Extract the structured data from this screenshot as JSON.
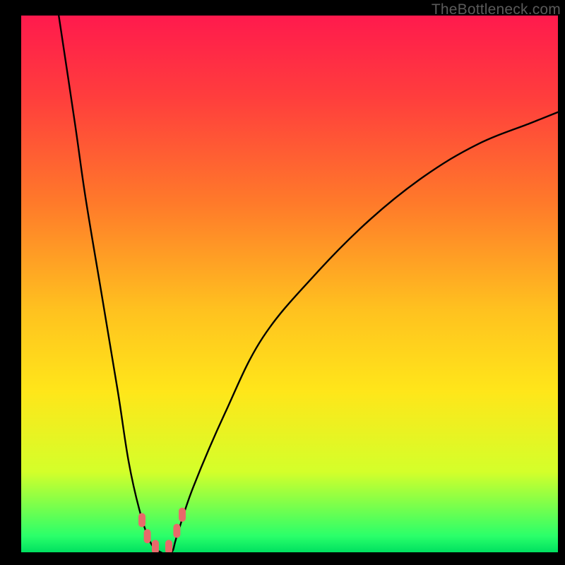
{
  "watermark": "TheBottleneck.com",
  "chart_data": {
    "type": "line",
    "title": "",
    "xlabel": "",
    "ylabel": "",
    "xlim": [
      0,
      100
    ],
    "ylim": [
      0,
      100
    ],
    "background_gradient": {
      "top": "#ff1a4d",
      "mid_high": "#ff7a2a",
      "mid": "#ffe61a",
      "bottom": "#00e060",
      "meaning_top": "bad",
      "meaning_bottom": "good"
    },
    "series": [
      {
        "name": "bottleneck-curve",
        "x": [
          7,
          10,
          12,
          15,
          18,
          20,
          22,
          24,
          26,
          28,
          29,
          32,
          38,
          45,
          55,
          65,
          75,
          85,
          95,
          100
        ],
        "y": [
          100,
          80,
          66,
          48,
          30,
          17,
          8,
          2,
          0,
          0,
          3,
          12,
          26,
          40,
          52,
          62,
          70,
          76,
          80,
          82
        ]
      }
    ],
    "markers": [
      {
        "name": "indicator",
        "x": 22.5,
        "y": 6
      },
      {
        "name": "indicator",
        "x": 23.5,
        "y": 3
      },
      {
        "name": "indicator",
        "x": 25.0,
        "y": 1
      },
      {
        "name": "indicator",
        "x": 27.5,
        "y": 1
      },
      {
        "name": "indicator",
        "x": 29.0,
        "y": 4
      },
      {
        "name": "indicator",
        "x": 30.0,
        "y": 7
      }
    ]
  }
}
